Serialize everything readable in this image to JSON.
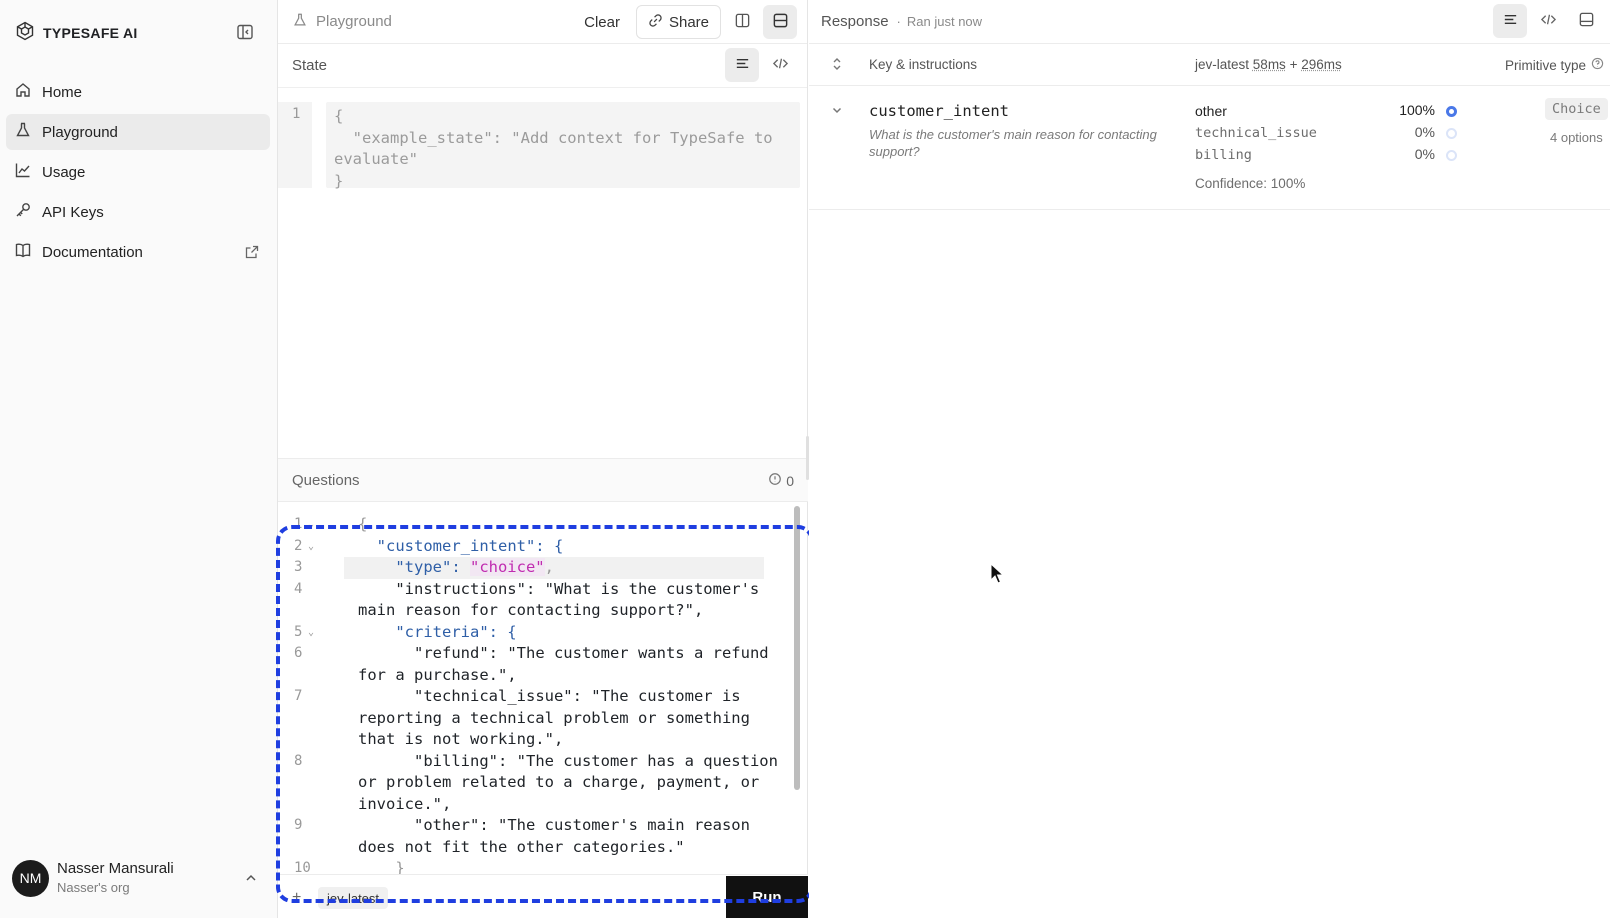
{
  "sidebar": {
    "brand": "TYPESAFE AI",
    "icons": {
      "logo": "typesafe-logo-icon",
      "collapse": "sidebar-collapse-icon"
    },
    "items": [
      {
        "label": "Home",
        "icon": "home-icon",
        "active": false
      },
      {
        "label": "Playground",
        "icon": "flask-icon",
        "active": true
      },
      {
        "label": "Usage",
        "icon": "chart-line-icon",
        "active": false
      },
      {
        "label": "API Keys",
        "icon": "key-icon",
        "active": false
      },
      {
        "label": "Documentation",
        "icon": "book-icon",
        "active": false,
        "external": true
      }
    ],
    "user": {
      "initials": "NM",
      "name": "Nasser Mansurali",
      "org": "Nasser's org"
    }
  },
  "playground": {
    "title": "Playground",
    "clear_label": "Clear",
    "share_label": "Share",
    "state": {
      "title": "State",
      "line_number": "1",
      "code": "{\n  \"example_state\": \"Add context for TypeSafe to\nevaluate\"\n}"
    },
    "questions": {
      "title": "Questions",
      "issue_count": "0",
      "lines": [
        {
          "num": "1",
          "fold": true,
          "text": "{"
        },
        {
          "num": "2",
          "fold": true,
          "text": "  \"customer_intent\": {"
        },
        {
          "num": "3",
          "fold": false,
          "text": "    \"type\": \"choice\","
        },
        {
          "num": "4",
          "fold": false,
          "text": "    \"instructions\": \"What is the customer's\nmain reason for contacting support?\","
        },
        {
          "num": "5",
          "fold": true,
          "text": "    \"criteria\": {"
        },
        {
          "num": "6",
          "fold": false,
          "text": "      \"refund\": \"The customer wants a refund\nfor a purchase.\","
        },
        {
          "num": "7",
          "fold": false,
          "text": "      \"technical_issue\": \"The customer is\nreporting a technical problem or something\nthat is not working.\","
        },
        {
          "num": "8",
          "fold": false,
          "text": "      \"billing\": \"The customer has a question\nor problem related to a charge, payment, or\ninvoice.\","
        },
        {
          "num": "9",
          "fold": false,
          "text": "      \"other\": \"The customer's main reason\ndoes not fit the other categories.\""
        },
        {
          "num": "10",
          "fold": false,
          "text": "    }"
        }
      ]
    },
    "model_chip": "jev-latest",
    "run_label": "Run"
  },
  "response": {
    "title": "Response",
    "ran_status": "Ran just now",
    "header": {
      "key_label": "Key & instructions",
      "model": "jev-latest",
      "latency_a": "58ms",
      "plus": "+",
      "latency_b": "296ms",
      "type_label": "Primitive type"
    },
    "row": {
      "key": "customer_intent",
      "instructions": "What is the customer's main reason for contacting support?",
      "options": [
        {
          "name": "other",
          "pct": "100%",
          "winner": true
        },
        {
          "name": "technical_issue",
          "pct": "0%",
          "winner": false
        },
        {
          "name": "billing",
          "pct": "0%",
          "winner": false
        }
      ],
      "confidence": "Confidence: 100%",
      "type": "Choice",
      "type_options": "4 options"
    }
  },
  "colors": {
    "accent": "#4a78e8",
    "annotation": "#1f3ee0",
    "run": "#111111"
  }
}
